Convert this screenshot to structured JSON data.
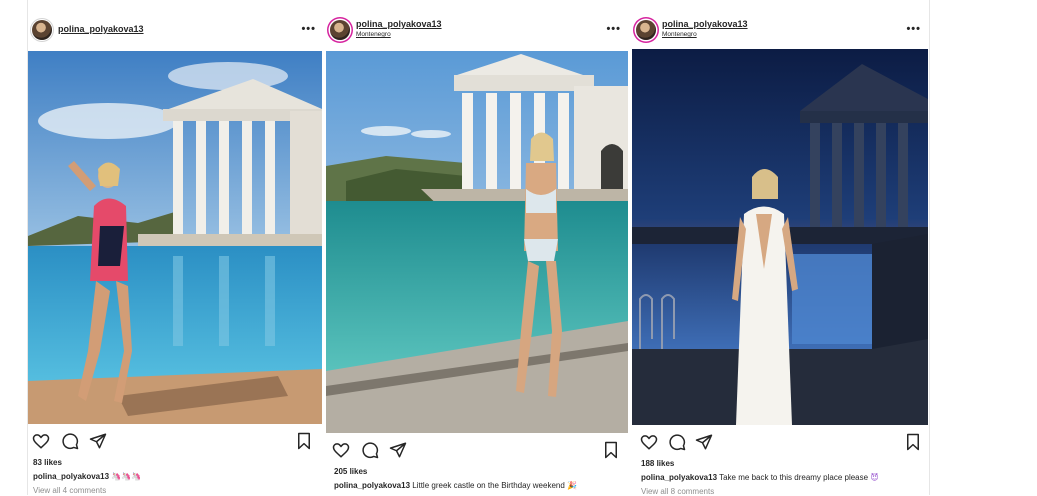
{
  "posts": [
    {
      "username": "polina_polyakova13",
      "location": "",
      "likes": "83 likes",
      "caption_user": "polina_polyakova13",
      "caption_text": "",
      "caption_emoji": "🦄🦄🦄",
      "comments": "View all 4 comments"
    },
    {
      "username": "polina_polyakova13",
      "location": "Montenegro",
      "likes": "205 likes",
      "caption_user": "polina_polyakova13",
      "caption_text": " Little greek castle on the Birthday weekend",
      "caption_emoji": "🎉",
      "comments": ""
    },
    {
      "username": "polina_polyakova13",
      "location": "Montenegro",
      "likes": "188 likes",
      "caption_user": "polina_polyakova13",
      "caption_text": " Take me back to this dreamy place please",
      "caption_emoji": "😈",
      "comments": "View all 8 comments"
    }
  ],
  "icons": {
    "like": "heart-icon",
    "comment": "comment-icon",
    "share": "share-icon",
    "save": "bookmark-icon",
    "more": "more-options-icon"
  },
  "colors": {
    "story_ring": "#d6249f",
    "text": "#262626",
    "muted": "#8e8e8e"
  }
}
